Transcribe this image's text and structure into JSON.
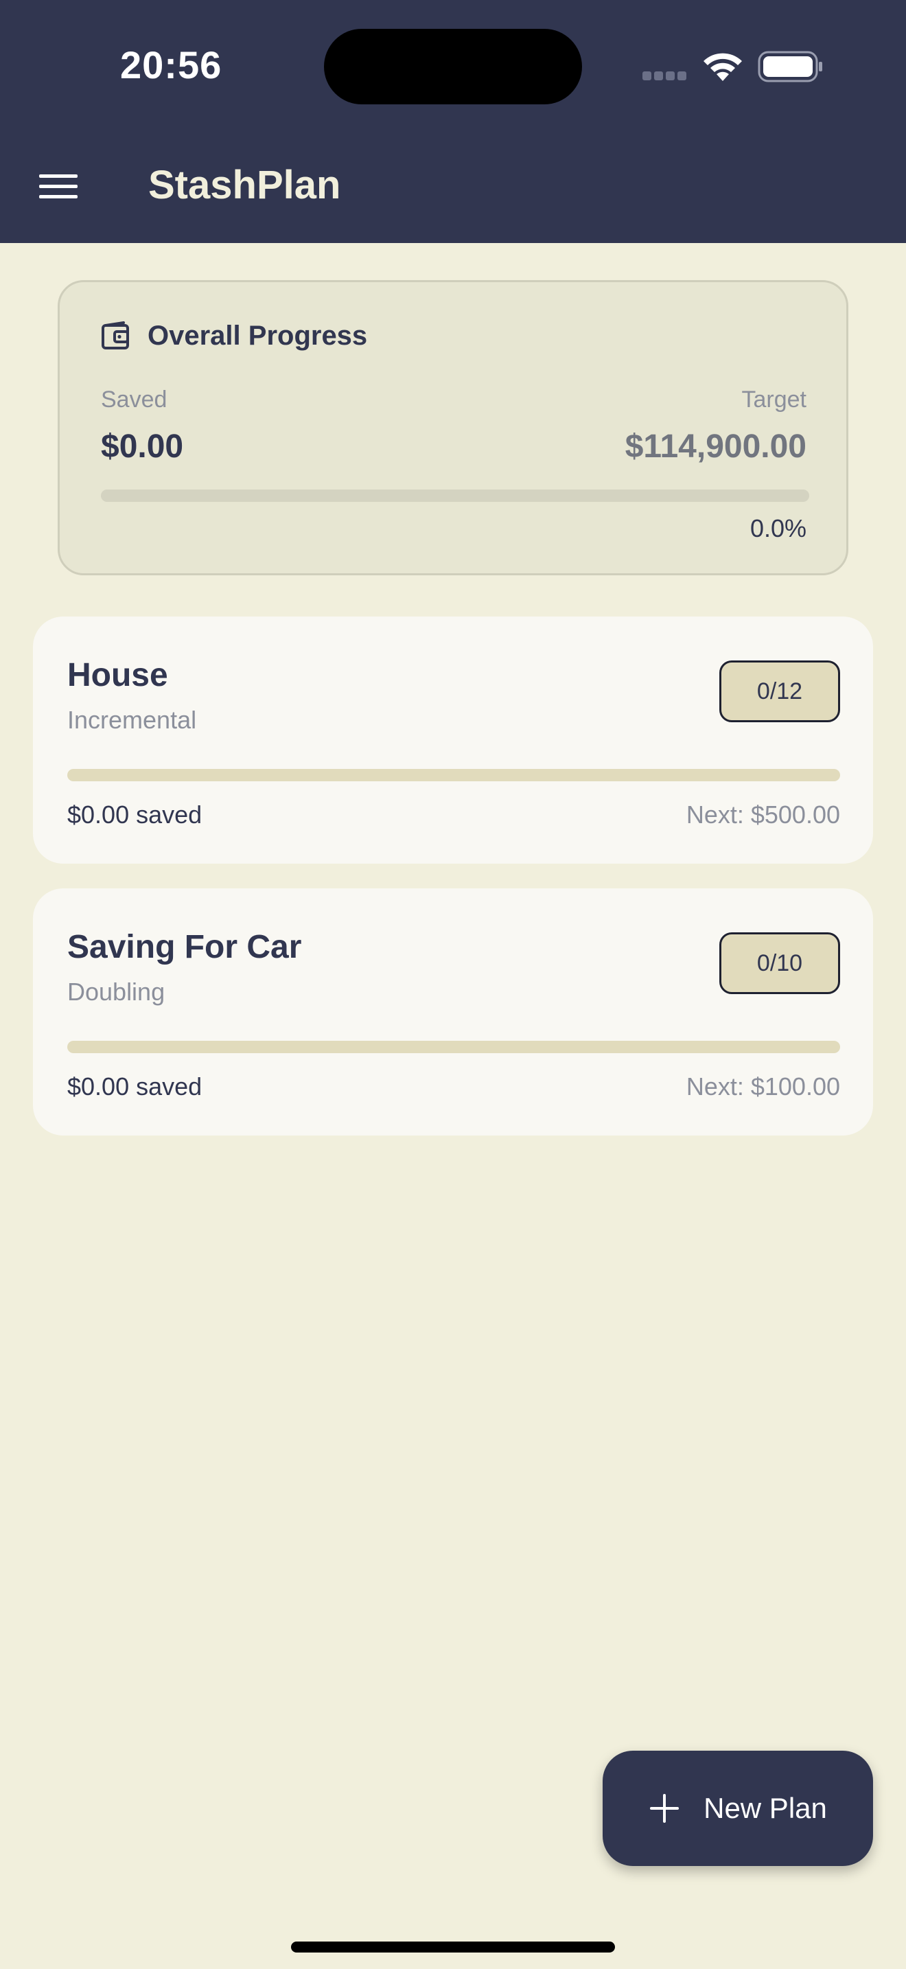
{
  "status_bar": {
    "time": "20:56"
  },
  "app_bar": {
    "title": "StashPlan",
    "menu_icon": "hamburger-menu-icon"
  },
  "overall": {
    "title": "Overall Progress",
    "icon": "wallet-icon",
    "saved_label": "Saved",
    "saved_value": "$0.00",
    "target_label": "Target",
    "target_value": "$114,900.00",
    "percent_text": "0.0%",
    "progress_fraction": 0.0
  },
  "plans": [
    {
      "name": "House",
      "type": "Incremental",
      "badge": "0/12",
      "saved": "$0.00 saved",
      "next": "Next: $500.00",
      "progress_fraction": 0.0
    },
    {
      "name": "Saving For Car",
      "type": "Doubling",
      "badge": "0/10",
      "saved": "$0.00 saved",
      "next": "Next: $100.00",
      "progress_fraction": 0.0
    }
  ],
  "fab": {
    "label": "New Plan",
    "icon": "plus-icon"
  },
  "colors": {
    "primary": "#313650",
    "background": "#f1efdc",
    "card": "#f9f8f3",
    "overall_card": "#e7e6d2",
    "badge": "#e1dbbc",
    "muted_text": "#8b8f9b"
  }
}
